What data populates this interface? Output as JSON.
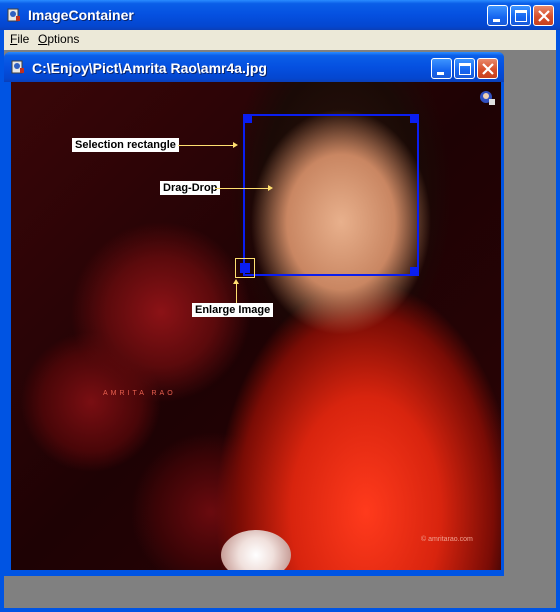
{
  "app": {
    "title": "ImageContainer"
  },
  "menu": {
    "file_label": "File",
    "file_mnemonic": "F",
    "file_rest": "ile",
    "options_label": "Options",
    "options_mnemonic": "O",
    "options_rest": "ptions"
  },
  "child_window": {
    "title": "C:\\Enjoy\\Pict\\Amrita Rao\\amr4a.jpg"
  },
  "annotations": {
    "selection": "Selection rectangle",
    "dragdrop": "Drag-Drop",
    "enlarge": "Enlarge Image"
  },
  "photo": {
    "watermark_text": "AMRITA RAO",
    "copyright_text": "© amritarao.com"
  },
  "colors": {
    "titlebar": "#0054e3",
    "selection": "#0a1ef0",
    "arrow": "#ffe070"
  }
}
